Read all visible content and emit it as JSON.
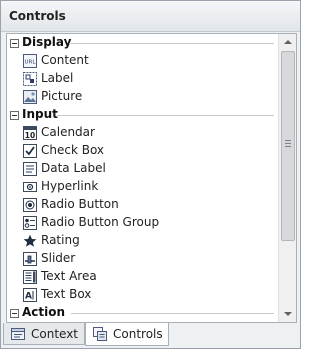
{
  "panel": {
    "title": "Controls"
  },
  "groups": [
    {
      "title": "Display",
      "items": [
        {
          "label": "Content",
          "icon": "url-content-icon"
        },
        {
          "label": "Label",
          "icon": "label-icon"
        },
        {
          "label": "Picture",
          "icon": "picture-icon"
        }
      ]
    },
    {
      "title": "Input",
      "items": [
        {
          "label": "Calendar",
          "icon": "calendar-icon"
        },
        {
          "label": "Check Box",
          "icon": "checkbox-icon"
        },
        {
          "label": "Data Label",
          "icon": "data-label-icon"
        },
        {
          "label": "Hyperlink",
          "icon": "hyperlink-icon"
        },
        {
          "label": "Radio Button",
          "icon": "radio-button-icon"
        },
        {
          "label": "Radio Button Group",
          "icon": "radio-button-group-icon"
        },
        {
          "label": "Rating",
          "icon": "star-icon"
        },
        {
          "label": "Slider",
          "icon": "slider-icon"
        },
        {
          "label": "Text Area",
          "icon": "text-area-icon"
        },
        {
          "label": "Text Box",
          "icon": "text-box-icon"
        }
      ]
    },
    {
      "title": "Action",
      "items": []
    }
  ],
  "tabs": [
    {
      "label": "Context",
      "icon": "context-icon",
      "active": false
    },
    {
      "label": "Controls",
      "icon": "controls-icon",
      "active": true
    }
  ],
  "calendar_icon_text": "10",
  "url_icon_text": "URL"
}
